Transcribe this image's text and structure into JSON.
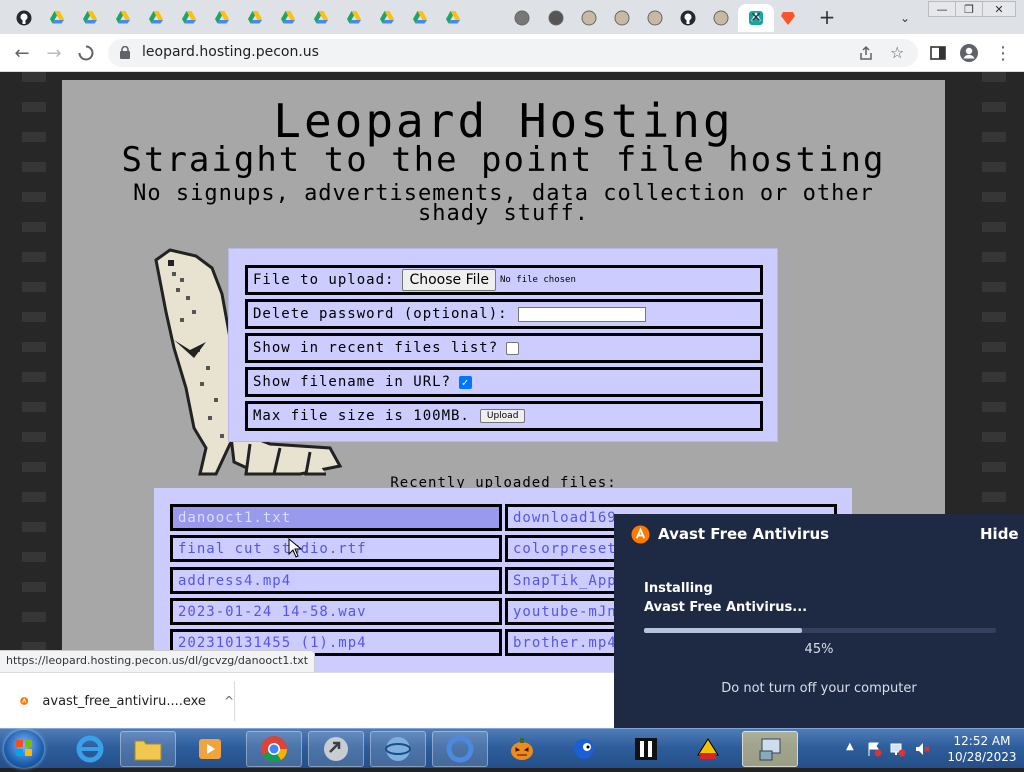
{
  "browser": {
    "tabs": [
      {
        "icon": "github-icon"
      },
      {
        "icon": "google-drive-icon"
      },
      {
        "icon": "google-drive-icon"
      },
      {
        "icon": "google-drive-icon"
      },
      {
        "icon": "google-drive-icon"
      },
      {
        "icon": "google-drive-icon"
      },
      {
        "icon": "google-drive-icon"
      },
      {
        "icon": "google-drive-icon"
      },
      {
        "icon": "google-drive-icon"
      },
      {
        "icon": "google-drive-icon"
      },
      {
        "icon": "google-drive-icon"
      },
      {
        "icon": "google-drive-icon"
      },
      {
        "icon": "google-drive-icon"
      },
      {
        "icon": "google-drive-icon"
      },
      {
        "icon": "globe-icon"
      },
      {
        "icon": "refresh-site-icon"
      },
      {
        "icon": "site-icon"
      },
      {
        "icon": "site-icon"
      },
      {
        "icon": "site-icon"
      },
      {
        "icon": "github-icon"
      },
      {
        "icon": "site-icon"
      },
      {
        "icon": "leopard-icon"
      },
      {
        "icon": "brave-icon"
      }
    ],
    "close_tab_glyph": "✕",
    "new_tab_glyph": "+",
    "tab_search_glyph": "⌄",
    "url": "leopard.hosting.pecon.us",
    "status_url": "https://leopard.hosting.pecon.us/dl/gcvzg/danooct1.txt"
  },
  "page": {
    "title": "Leopard Hosting",
    "subtitle": "Straight to the point file hosting",
    "tagline": "No signups, advertisements, data collection or other shady stuff.",
    "form": {
      "file_label": "File to upload:",
      "choose_file": "Choose File",
      "no_file": "No file chosen",
      "password_label": "Delete password (optional):",
      "recent_label": "Show in recent files list?",
      "recent_checked": false,
      "filename_label": "Show filename in URL?",
      "filename_checked": true,
      "maxsize_label": "Max file size is 100MB.",
      "upload_button": "Upload"
    },
    "recent_heading": "Recently uploaded files:",
    "recent_files": [
      [
        "danooct1.txt",
        "download169"
      ],
      [
        "final cut studio.rtf",
        "colorpreset"
      ],
      [
        "address4.mp4",
        "SnapTik_App"
      ],
      [
        "2023-01-24 14-58.wav",
        "youtube-mJn"
      ],
      [
        "202310131455 (1).mp4",
        "brother.mp4"
      ]
    ]
  },
  "download_shelf": {
    "filename": "avast_free_antiviru....exe",
    "chevron": "^"
  },
  "avast": {
    "title": "Avast Free Antivirus",
    "hide": "Hide",
    "status_line1": "Installing",
    "status_line2": "Avast Free Antivirus...",
    "progress": 45,
    "progress_label": "45%",
    "warning": "Do not turn off your computer",
    "accent": "#ff7800"
  },
  "taskbar": {
    "time": "12:52 AM",
    "date": "10/28/2023"
  }
}
